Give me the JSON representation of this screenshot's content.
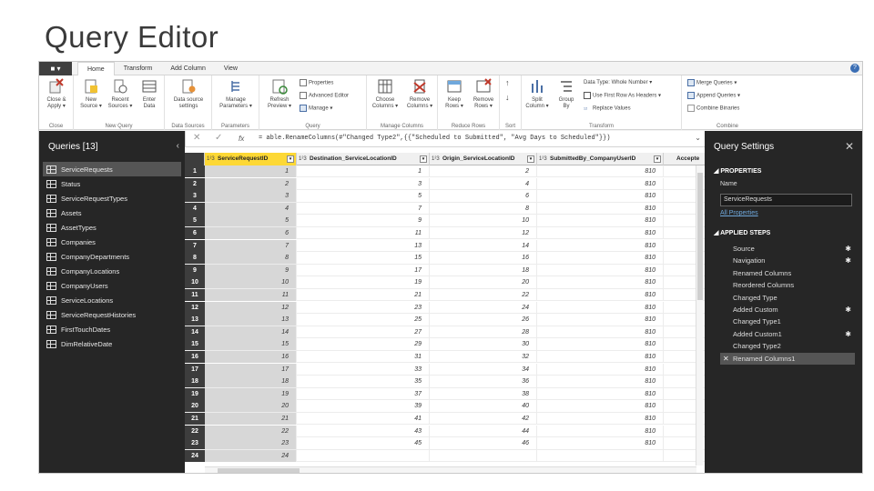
{
  "slide": {
    "title": "Query Editor"
  },
  "menu": {
    "file": "■ ▾",
    "tabs": [
      "Home",
      "Transform",
      "Add Column",
      "View"
    ],
    "help": "?"
  },
  "ribbon": {
    "groups": [
      {
        "label": "Close",
        "buttons": [
          "Close &\nApply ▾"
        ]
      },
      {
        "label": "New Query",
        "buttons": [
          "New\nSource ▾",
          "Recent\nSources ▾",
          "Enter\nData"
        ]
      },
      {
        "label": "Data Sources",
        "buttons": [
          "Data source\nsettings"
        ]
      },
      {
        "label": "Parameters",
        "buttons": [
          "Manage\nParameters ▾"
        ]
      },
      {
        "label": "Query",
        "buttons": [
          "Refresh\nPreview ▾"
        ],
        "small": [
          "Properties",
          "Advanced Editor",
          "Manage ▾"
        ]
      },
      {
        "label": "Manage Columns",
        "buttons": [
          "Choose\nColumns ▾",
          "Remove\nColumns ▾"
        ]
      },
      {
        "label": "Reduce Rows",
        "buttons": [
          "Keep\nRows ▾",
          "Remove\nRows ▾"
        ]
      },
      {
        "label": "Sort",
        "buttons": []
      },
      {
        "label": "Transform",
        "buttons": [
          "Split\nColumn ▾",
          "Group\nBy"
        ],
        "small": [
          "Data Type: Whole Number ▾",
          "Use First Row As Headers ▾",
          "Replace Values"
        ]
      },
      {
        "label": "Combine",
        "small": [
          "Merge Queries ▾",
          "Append Queries ▾",
          "Combine Binaries"
        ]
      }
    ]
  },
  "queries": {
    "header": "Queries [13]",
    "collapse": "‹",
    "items": [
      "ServiceRequests",
      "Status",
      "ServiceRequestTypes",
      "Assets",
      "AssetTypes",
      "Companies",
      "CompanyDepartments",
      "CompanyLocations",
      "CompanyUsers",
      "ServiceLocations",
      "ServiceRequestHistories",
      "FirstTouchDates",
      "DimRelativeDate"
    ],
    "selected": 0
  },
  "formula": {
    "cancel": "✕",
    "commit": "✓",
    "fx": "fx",
    "text": "= able.RenameColumns(#\"Changed Type2\",{{\"Scheduled to Submitted\", \"Avg Days to Scheduled\"}})",
    "expand": "⌄"
  },
  "grid": {
    "columns": [
      {
        "type": "1²3",
        "name": "ServiceRequestID"
      },
      {
        "type": "1²3",
        "name": "Destination_ServiceLocationID"
      },
      {
        "type": "1²3",
        "name": "Origin_ServiceLocationID"
      },
      {
        "type": "1²3",
        "name": "SubmittedBy_CompanyUserID"
      },
      {
        "type": "",
        "name": "Accepte"
      }
    ],
    "rows": [
      [
        "1",
        "1",
        "2",
        "810"
      ],
      [
        "2",
        "3",
        "4",
        "810"
      ],
      [
        "3",
        "5",
        "6",
        "810"
      ],
      [
        "4",
        "7",
        "8",
        "810"
      ],
      [
        "5",
        "9",
        "10",
        "810"
      ],
      [
        "6",
        "11",
        "12",
        "810"
      ],
      [
        "7",
        "13",
        "14",
        "810"
      ],
      [
        "8",
        "15",
        "16",
        "810"
      ],
      [
        "9",
        "17",
        "18",
        "810"
      ],
      [
        "10",
        "19",
        "20",
        "810"
      ],
      [
        "11",
        "21",
        "22",
        "810"
      ],
      [
        "12",
        "23",
        "24",
        "810"
      ],
      [
        "13",
        "25",
        "26",
        "810"
      ],
      [
        "14",
        "27",
        "28",
        "810"
      ],
      [
        "15",
        "29",
        "30",
        "810"
      ],
      [
        "16",
        "31",
        "32",
        "810"
      ],
      [
        "17",
        "33",
        "34",
        "810"
      ],
      [
        "18",
        "35",
        "36",
        "810"
      ],
      [
        "19",
        "37",
        "38",
        "810"
      ],
      [
        "20",
        "39",
        "40",
        "810"
      ],
      [
        "21",
        "41",
        "42",
        "810"
      ],
      [
        "22",
        "43",
        "44",
        "810"
      ],
      [
        "23",
        "45",
        "46",
        "810"
      ],
      [
        "24",
        "",
        "",
        " "
      ]
    ],
    "row_numbers": [
      "1",
      "2",
      "3",
      "4",
      "5",
      "6",
      "7",
      "8",
      "9",
      "10",
      "11",
      "12",
      "13",
      "14",
      "15",
      "16",
      "17",
      "18",
      "19",
      "20",
      "21",
      "22",
      "23",
      "24"
    ]
  },
  "settings": {
    "header": "Query Settings",
    "close": "✕",
    "properties_label": "◢ PROPERTIES",
    "name_label": "Name",
    "name_value": "ServiceRequests",
    "all_properties": "All Properties",
    "applied_label": "◢ APPLIED STEPS",
    "steps": [
      {
        "label": "Source",
        "gear": true
      },
      {
        "label": "Navigation",
        "gear": true
      },
      {
        "label": "Renamed Columns",
        "gear": false
      },
      {
        "label": "Reordered Columns",
        "gear": false
      },
      {
        "label": "Changed Type",
        "gear": false
      },
      {
        "label": "Added Custom",
        "gear": true
      },
      {
        "label": "Changed Type1",
        "gear": false
      },
      {
        "label": "Added Custom1",
        "gear": true
      },
      {
        "label": "Changed Type2",
        "gear": false
      },
      {
        "label": "Renamed Columns1",
        "gear": false
      }
    ],
    "selected_step": 9
  }
}
